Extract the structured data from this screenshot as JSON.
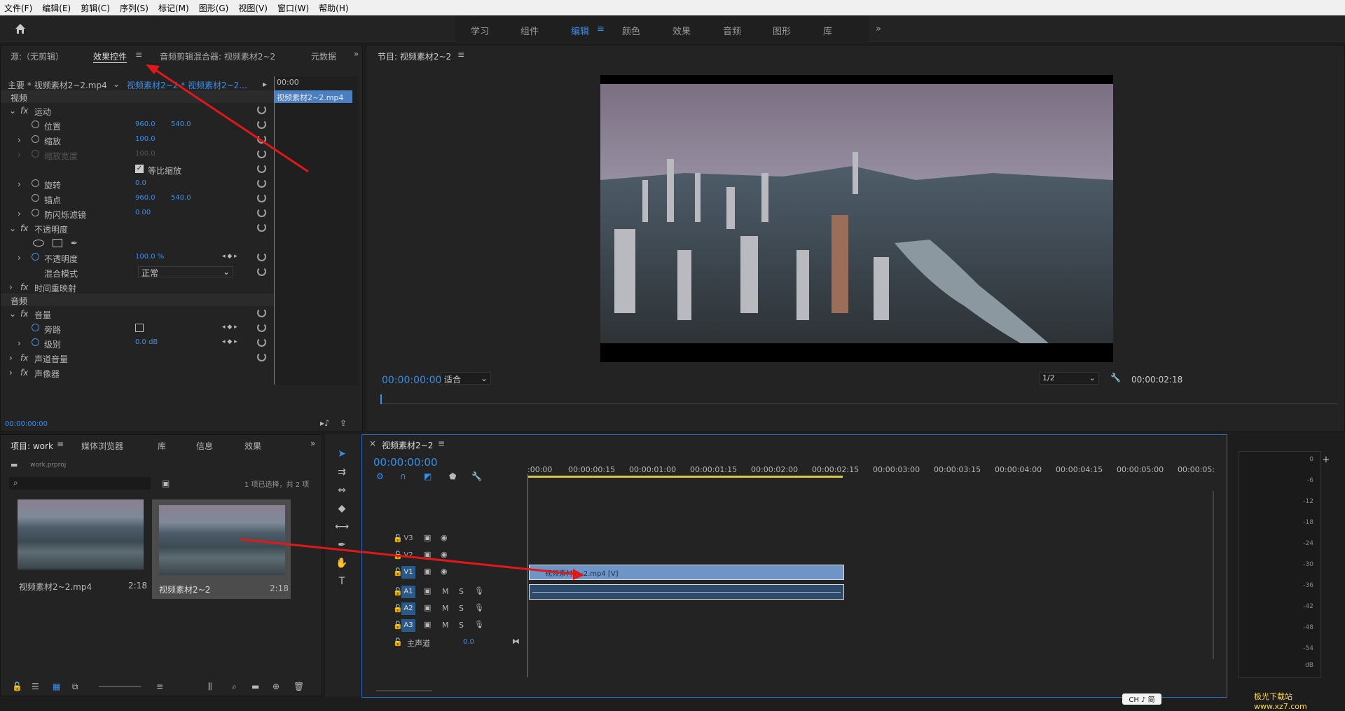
{
  "menu": [
    "文件(F)",
    "编辑(E)",
    "剪辑(C)",
    "序列(S)",
    "标记(M)",
    "图形(G)",
    "视图(V)",
    "窗口(W)",
    "帮助(H)"
  ],
  "workspaces": [
    "学习",
    "组件",
    "编辑",
    "颜色",
    "效果",
    "音频",
    "图形",
    "库"
  ],
  "workspace_active": "编辑",
  "source_tabs": {
    "source": "源:（无剪辑）",
    "effect_controls": "效果控件",
    "audio_mixer": "音频剪辑混合器: 视频素材2~2",
    "metadata": "元数据"
  },
  "ec": {
    "master": "主要 * 视频素材2~2.mp4",
    "seq": "视频素材2~2 * 视频素材2~2...",
    "time": "00:00",
    "clip": "视频素材2~2.mp4",
    "video_hdr": "视频",
    "motion": "运动",
    "position": "位置",
    "pos_x": "960.0",
    "pos_y": "540.0",
    "scale": "缩放",
    "scale_v": "100.0",
    "scale_w": "缩放宽度",
    "scale_w_v": "100.0",
    "uniform": "等比缩放",
    "rotation": "旋转",
    "rot_v": "0.0",
    "anchor": "锚点",
    "anc_x": "960.0",
    "anc_y": "540.0",
    "flicker": "防闪烁滤镜",
    "flick_v": "0.00",
    "opacity_grp": "不透明度",
    "opacity": "不透明度",
    "opacity_v": "100.0 %",
    "blend": "混合模式",
    "blend_v": "正常",
    "remap": "时间重映射",
    "audio_hdr": "音频",
    "volume": "音量",
    "bypass": "旁路",
    "level": "级别",
    "level_v": "0.0 dB",
    "chvol": "声道音量",
    "panner": "声像器",
    "timecode": "00:00:00:00"
  },
  "program": {
    "title": "节目: 视频素材2~2",
    "timecode": "00:00:00:00",
    "fit": "适合",
    "res": "1/2",
    "duration": "00:00:02:18"
  },
  "project": {
    "tabs": [
      "项目: work",
      "媒体浏览器",
      "库",
      "信息",
      "效果"
    ],
    "file": "work.prproj",
    "selected": "1 项已选择，共 2 项",
    "items": [
      {
        "name": "视频素材2~2.mp4",
        "dur": "2:18"
      },
      {
        "name": "视频素材2~2",
        "dur": "2:18"
      }
    ]
  },
  "timeline": {
    "title": "视频素材2~2",
    "timecode": "00:00:00:00",
    "ticks": [
      ":00:00",
      "00:00:00:15",
      "00:00:01:00",
      "00:00:01:15",
      "00:00:02:00",
      "00:00:02:15",
      "00:00:03:00",
      "00:00:03:15",
      "00:00:04:00",
      "00:00:04:15",
      "00:00:05:00",
      "00:00:05:"
    ],
    "tracks": [
      "V3",
      "V2",
      "V1",
      "A1",
      "A2",
      "A3"
    ],
    "master": "主声道",
    "master_v": "0.0",
    "clip_v": "视频素材2~2.mp4 [V]"
  },
  "meter": [
    "0",
    "-6",
    "-12",
    "-18",
    "-24",
    "-30",
    "-36",
    "-42",
    "-48",
    "-54",
    "dB"
  ],
  "ime": "CH ♪ 简",
  "watermark": "极光下载站 www.xz7.com"
}
